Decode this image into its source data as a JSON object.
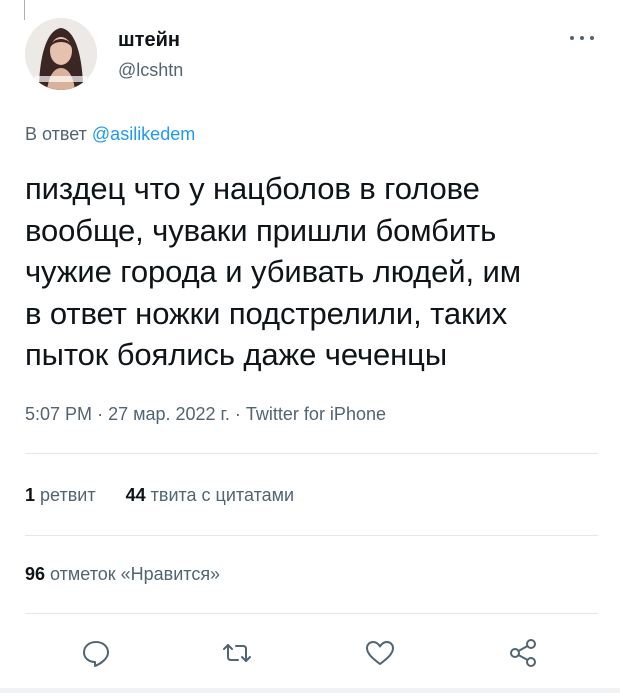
{
  "user": {
    "name": "штейн",
    "handle": "@lcshtn"
  },
  "reply_to": {
    "prefix": "В ответ",
    "handle": "@asilikedem"
  },
  "tweet": {
    "lines": [
      "пиздец что у нацболов в голове",
      "вообще, чуваки пришли бомбить",
      "чужие города и убивать людей, им",
      "в ответ ножки подстрелили, таких",
      "пыток боялись даже чеченцы"
    ]
  },
  "meta": {
    "time": "5:07 PM",
    "date": "27 мар. 2022 г.",
    "source": "Twitter for iPhone"
  },
  "stats": {
    "retweets_count": "1",
    "retweets_label": "ретвит",
    "quotes_count": "44",
    "quotes_label": "твита с цитатами",
    "likes_count": "96",
    "likes_label": "отметок «Нравится»"
  },
  "icons": {
    "more": "more-dots-icon",
    "reply": "reply-icon",
    "retweet": "retweet-icon",
    "like": "heart-icon",
    "share": "share-icon"
  },
  "colors": {
    "text": "#0f1419",
    "secondary": "#536471",
    "link": "#1d9bf0",
    "divider": "#e4e8eb"
  }
}
